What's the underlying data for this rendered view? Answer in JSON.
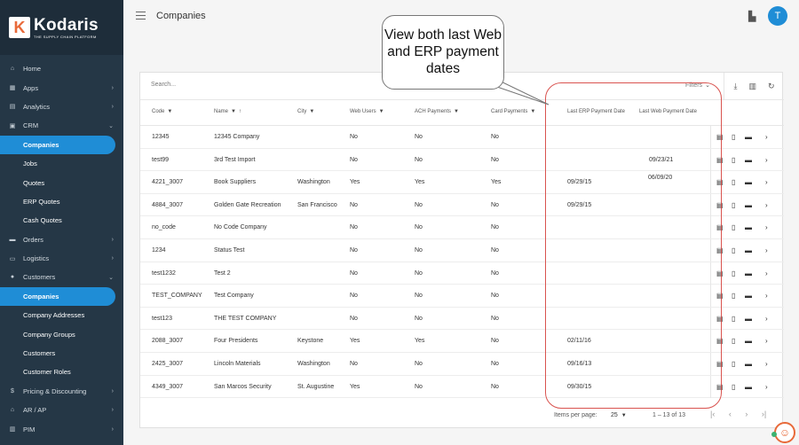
{
  "brand": {
    "logo_letter": "K",
    "name": "Kodaris",
    "tagline": "THE SUPPLY CHAIN PLATFORM"
  },
  "sidebar": {
    "items": [
      {
        "label": "Home",
        "icon": "home-icon",
        "glyph": "⌂",
        "chevron": ""
      },
      {
        "label": "Apps",
        "icon": "apps-icon",
        "glyph": "▦",
        "chevron": "›"
      },
      {
        "label": "Analytics",
        "icon": "analytics-icon",
        "glyph": "▤",
        "chevron": "›"
      },
      {
        "label": "CRM",
        "icon": "crm-icon",
        "glyph": "▣",
        "chevron": "⌄"
      },
      {
        "label": "Companies",
        "sub": true,
        "active": true
      },
      {
        "label": "Jobs",
        "sub": true
      },
      {
        "label": "Quotes",
        "sub": true
      },
      {
        "label": "ERP Quotes",
        "sub": true
      },
      {
        "label": "Cash Quotes",
        "sub": true
      },
      {
        "label": "Orders",
        "icon": "truck-icon",
        "glyph": "▬",
        "chevron": "›"
      },
      {
        "label": "Logistics",
        "icon": "logistics-icon",
        "glyph": "▭",
        "chevron": "›"
      },
      {
        "label": "Customers",
        "icon": "customers-icon",
        "glyph": "●",
        "chevron": "⌄"
      },
      {
        "label": "Companies",
        "sub": true,
        "active": true
      },
      {
        "label": "Company Addresses",
        "sub": true
      },
      {
        "label": "Company Groups",
        "sub": true
      },
      {
        "label": "Customers",
        "sub": true
      },
      {
        "label": "Customer Roles",
        "sub": true
      },
      {
        "label": "Pricing & Discounting",
        "icon": "dollar-icon",
        "glyph": "$",
        "chevron": "›"
      },
      {
        "label": "AR / AP",
        "icon": "bank-icon",
        "glyph": "⌂",
        "chevron": "›"
      },
      {
        "label": "PIM",
        "icon": "pim-icon",
        "glyph": "▥",
        "chevron": "›"
      }
    ]
  },
  "header": {
    "title": "Companies",
    "avatar_initial": "T"
  },
  "toolbar": {
    "search_placeholder": "Search...",
    "filters_label": "Filters"
  },
  "table": {
    "columns": [
      "Code",
      "Name",
      "City",
      "Web Users",
      "ACH Payments",
      "Card Payments",
      "Last ERP Payment Date",
      "Last Web Payment Date"
    ],
    "rows": [
      [
        "12345",
        "12345 Company",
        "",
        "No",
        "No",
        "No",
        "",
        ""
      ],
      [
        "test99",
        "3rd Test Import",
        "",
        "No",
        "No",
        "No",
        "",
        "09/23/21"
      ],
      [
        "4221_3007",
        "Book Suppliers",
        "Washington",
        "Yes",
        "Yes",
        "Yes",
        "09/29/15",
        "06/09/20"
      ],
      [
        "4884_3007",
        "Golden Gate Recreation",
        "San Francisco",
        "No",
        "No",
        "No",
        "09/29/15",
        ""
      ],
      [
        "no_code",
        "No Code Company",
        "",
        "No",
        "No",
        "No",
        "",
        ""
      ],
      [
        "1234",
        "Status Test",
        "",
        "No",
        "No",
        "No",
        "",
        ""
      ],
      [
        "test1232",
        "Test 2",
        "",
        "No",
        "No",
        "No",
        "",
        ""
      ],
      [
        "TEST_COMPANY",
        "Test Company",
        "",
        "No",
        "No",
        "No",
        "",
        ""
      ],
      [
        "test123",
        "THE TEST COMPANY",
        "",
        "No",
        "No",
        "No",
        "",
        ""
      ],
      [
        "2088_3007",
        "Four Presidents",
        "Keystone",
        "Yes",
        "Yes",
        "No",
        "02/11/16",
        ""
      ],
      [
        "2425_3007",
        "Lincoln Materials",
        "Washington",
        "No",
        "No",
        "No",
        "09/16/13",
        ""
      ],
      [
        "4349_3007",
        "San Marcos Security",
        "St. Augustine",
        "Yes",
        "No",
        "No",
        "09/30/15",
        ""
      ]
    ]
  },
  "pagination": {
    "items_per_page_label": "Items per page:",
    "items_per_page": "25",
    "range": "1 – 13 of 13"
  },
  "callout": {
    "text": "View both last Web and ERP payment dates"
  },
  "colors": {
    "sidebar": "#253746",
    "accent": "#1f8dd6",
    "highlight": "#d9534f"
  }
}
